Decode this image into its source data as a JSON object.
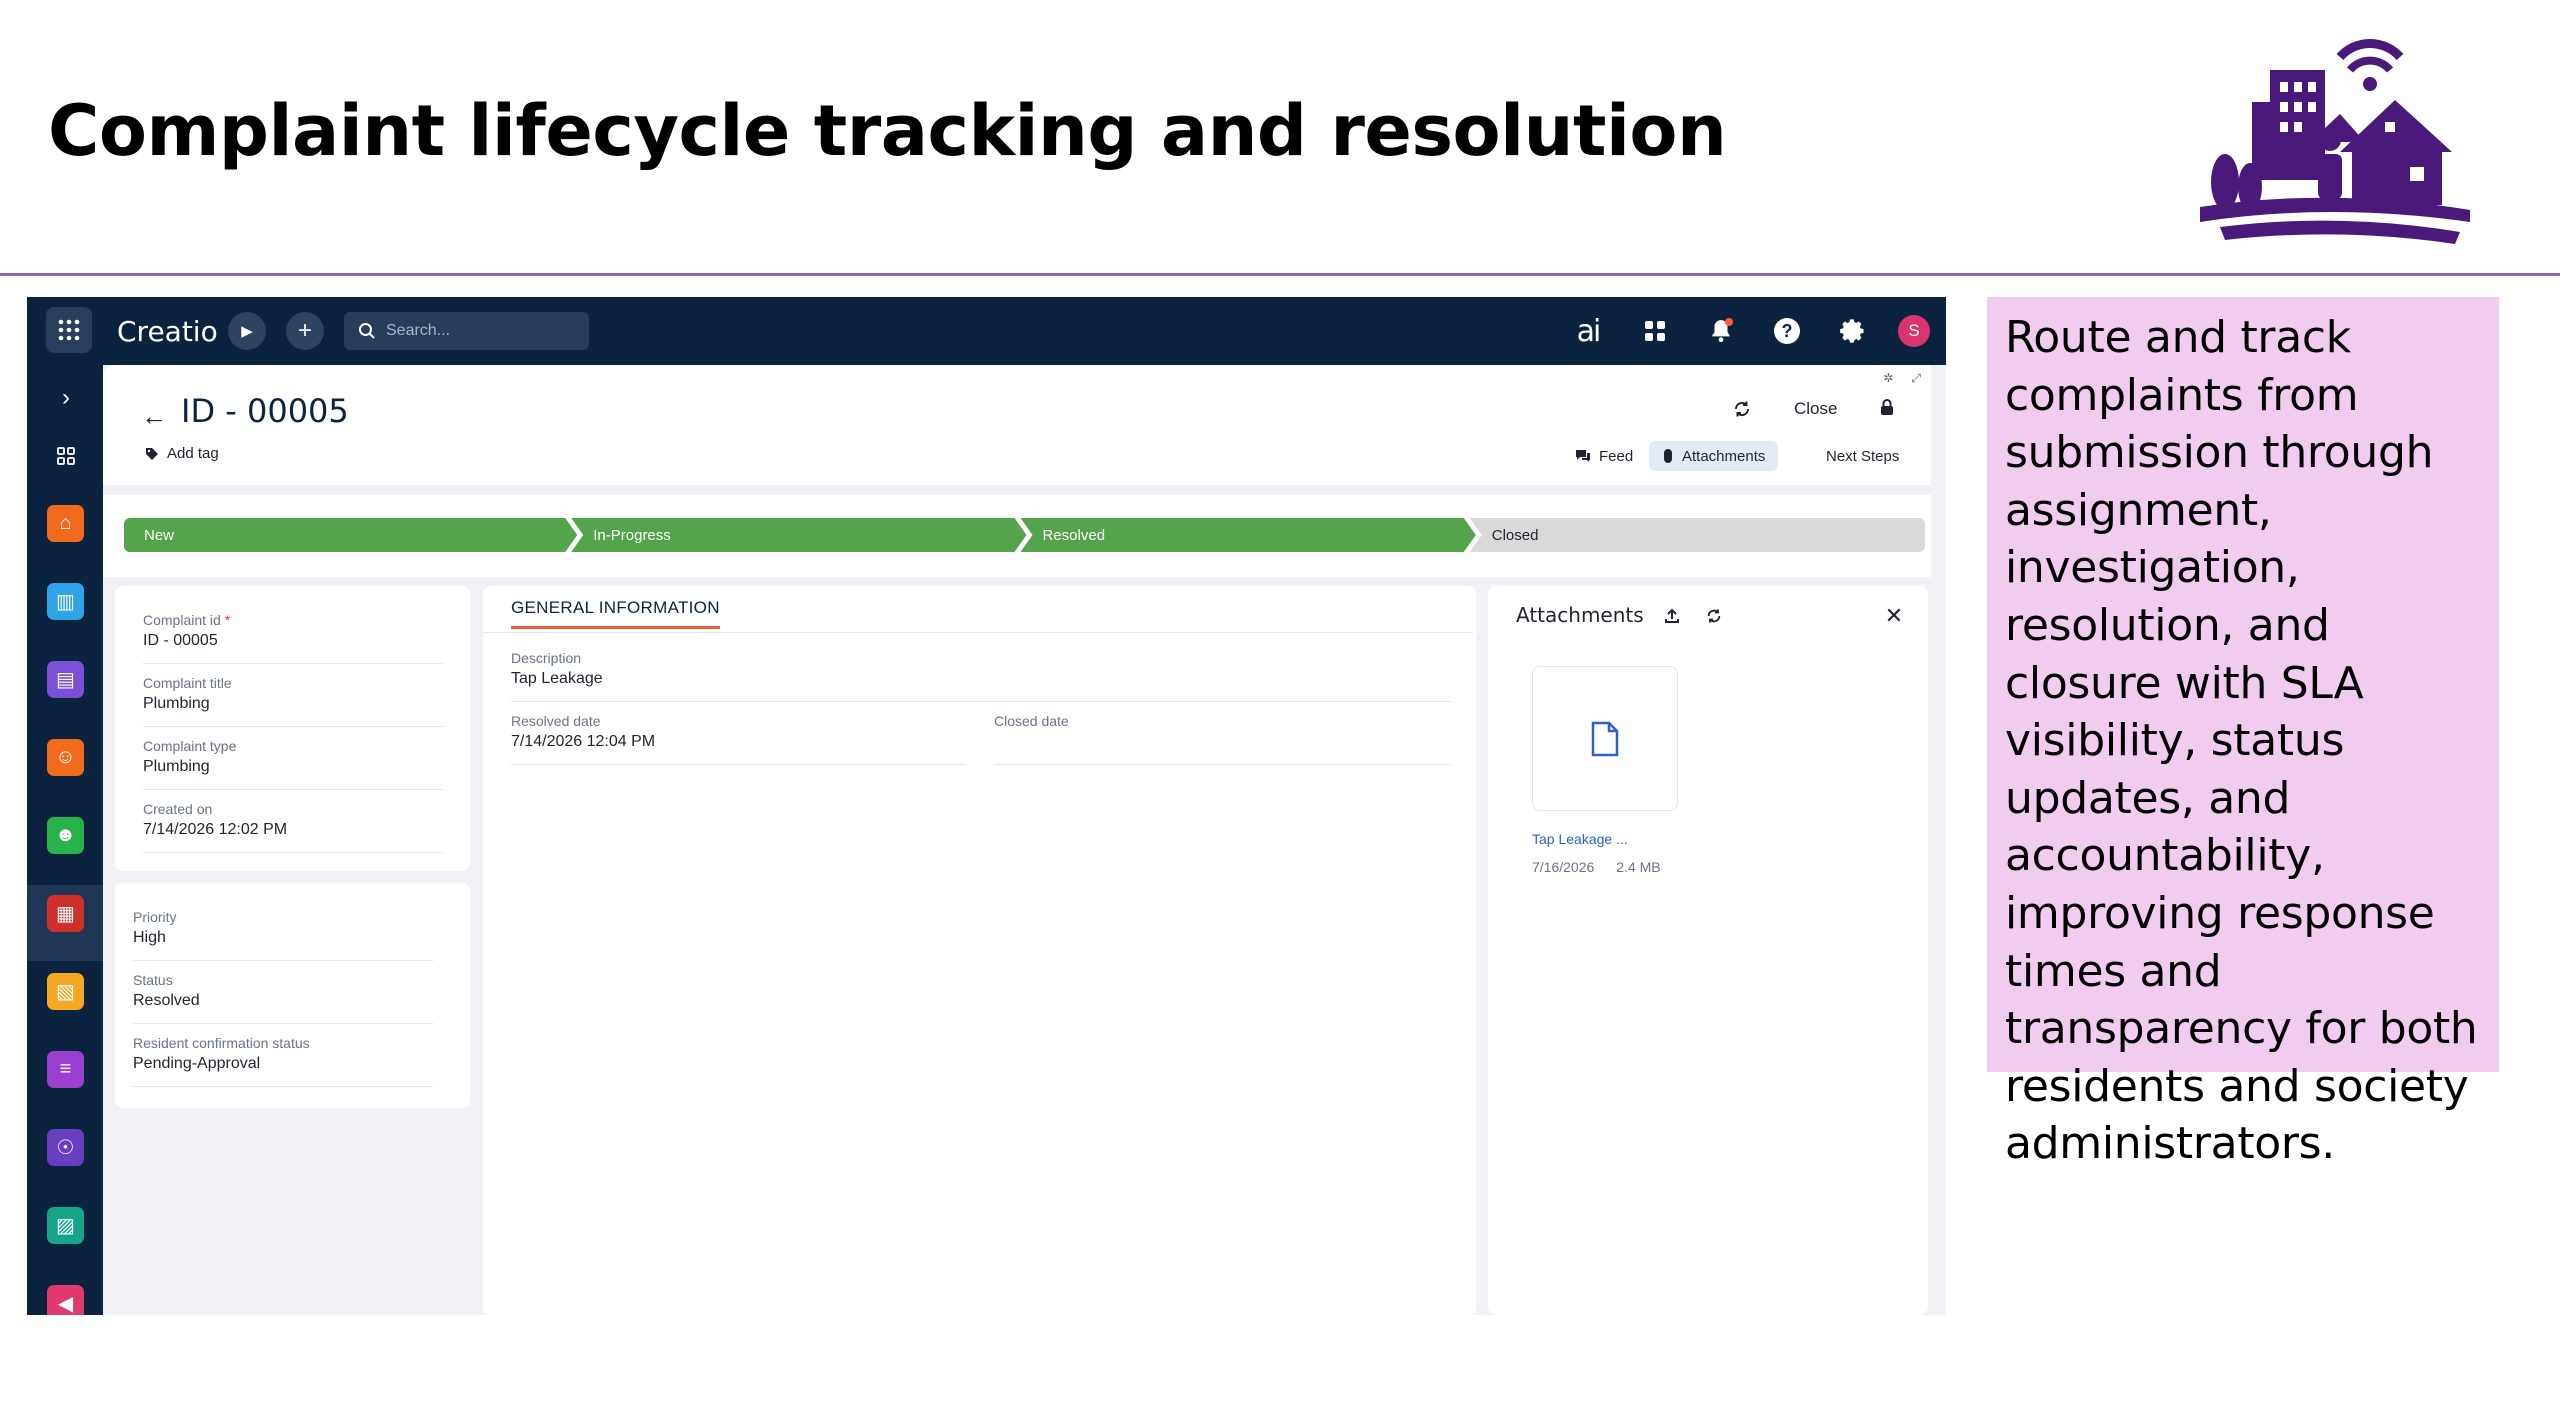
{
  "slide": {
    "title": "Complaint lifecycle tracking and resolution",
    "description": "Route and track complaints from submission through assignment, investigation, resolution, and closure with SLA visibility, status updates, and accountability, improving response times and transparency for both residents and society administrators."
  },
  "topbar": {
    "brand": "Creatio",
    "search_placeholder": "Search...",
    "ai_label": "ai",
    "avatar_initial": "S"
  },
  "sidebar": {
    "icons": [
      "home-icon",
      "building-icon",
      "checklist-icon",
      "resident-icon",
      "person-icon",
      "complaint-icon",
      "invoice-icon",
      "filter-icon",
      "helpdesk-icon",
      "report-icon",
      "megaphone-icon"
    ],
    "colors": [
      "#f26a1b",
      "#2fa3e8",
      "#7b4fd6",
      "#f26a1b",
      "#29b24a",
      "#d12f2a",
      "#f5a623",
      "#9b3fd1",
      "#6a3fbf",
      "#17a589",
      "#e23a6e"
    ]
  },
  "record": {
    "title": "ID - 00005",
    "add_tag": "Add tag",
    "close_label": "Close",
    "tabs": [
      "Feed",
      "Attachments",
      "Next Steps"
    ]
  },
  "stages": [
    {
      "label": "New",
      "done": true
    },
    {
      "label": "In-Progress",
      "done": true
    },
    {
      "label": "Resolved",
      "done": true
    },
    {
      "label": "Closed",
      "done": false
    }
  ],
  "left_card": {
    "fields": [
      {
        "label": "Complaint id",
        "value": "ID - 00005",
        "required": true
      },
      {
        "label": "Complaint title",
        "value": "Plumbing"
      },
      {
        "label": "Complaint type",
        "value": "Plumbing"
      },
      {
        "label": "Created on",
        "value": "7/14/2026 12:02 PM"
      }
    ]
  },
  "left_card2": {
    "fields": [
      {
        "label": "Priority",
        "value": "High"
      },
      {
        "label": "Status",
        "value": "Resolved"
      },
      {
        "label": "Resident confirmation status",
        "value": "Pending-Approval"
      }
    ]
  },
  "general": {
    "tab": "GENERAL INFORMATION",
    "description_label": "Description",
    "description_value": "Tap Leakage",
    "resolved_label": "Resolved date",
    "resolved_value": "7/14/2026 12:04 PM",
    "closed_label": "Closed date",
    "closed_value": ""
  },
  "attachments": {
    "title": "Attachments",
    "file_name": "Tap Leakage ...",
    "file_date": "7/16/2026",
    "file_size": "2.4 MB"
  },
  "colors": {
    "navy": "#0c2340",
    "stage_done": "#53a44a",
    "stage_todo": "#d9d9d9",
    "callout_bg": "#f0cdee",
    "divider": "#8b6bb1",
    "logo_purple": "#4a1a7a"
  }
}
